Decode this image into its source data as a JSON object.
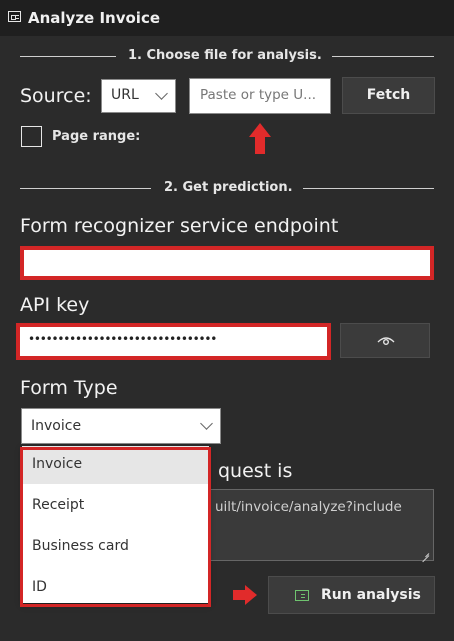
{
  "window": {
    "title": "Analyze Invoice",
    "title_icon": "form-icon"
  },
  "section1": {
    "label": "1. Choose file for analysis."
  },
  "source": {
    "label": "Source:",
    "type_selected": "URL",
    "url_placeholder": "Paste or type U...",
    "fetch_label": "Fetch",
    "page_range_label": "Page range:"
  },
  "section2": {
    "label": "2. Get prediction."
  },
  "endpoint": {
    "label": "Form recognizer service endpoint",
    "value": ""
  },
  "apikey": {
    "label": "API key",
    "masked_value": "••••••••••••••••••••••••••••••••",
    "reveal_icon": "eye-icon"
  },
  "formtype": {
    "label": "Form Type",
    "selected": "Invoice",
    "options": [
      "Invoice",
      "Receipt",
      "Business card",
      "ID"
    ]
  },
  "request": {
    "label_tail": "quest is",
    "url_tail": "uilt/invoice/analyze?include"
  },
  "run": {
    "label": "Run analysis",
    "icon": "form-icon"
  },
  "highlight_color": "#d32626",
  "accent_green": "#6fc36f"
}
